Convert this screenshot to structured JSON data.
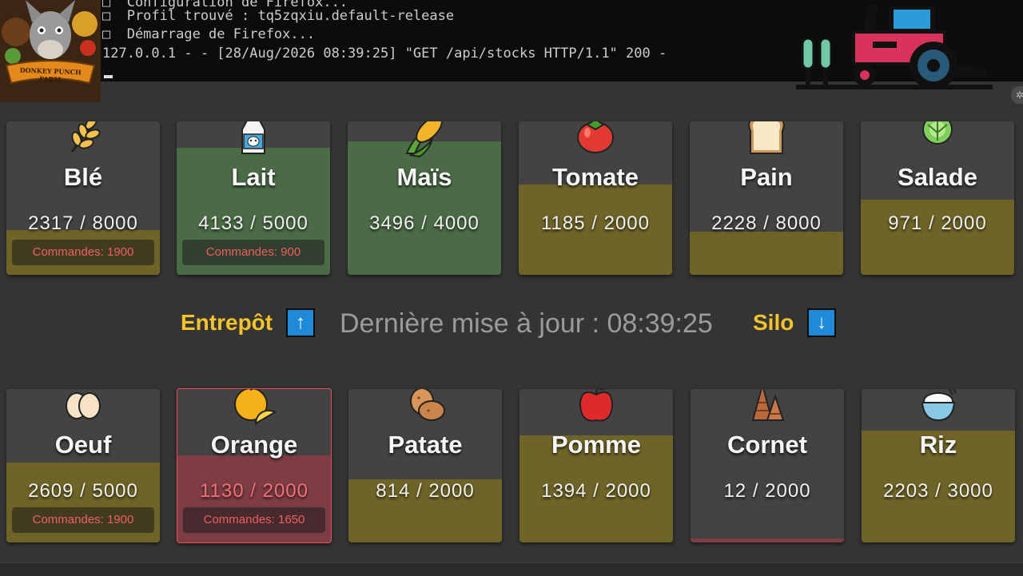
{
  "terminal": {
    "lines": [
      "□  Configuration de Firefox...",
      "□  Profil trouvé : tq5zqxiu.default-release",
      "□  Démarrage de Firefox...",
      "127.0.0.1 - - [28/Aug/2026 08:39:25] \"GET /api/stocks HTTP/1.1\" 200 -"
    ]
  },
  "logo": {
    "text": "DONKEY PUNCH FARM",
    "icon": "donkey-logo"
  },
  "top_row": [
    {
      "name": "Blé",
      "qty": "2317 / 8000",
      "orders": "Commandes: 1900",
      "icon": "wheat-icon",
      "level": 0.29,
      "status": "low"
    },
    {
      "name": "Lait",
      "qty": "4133 / 5000",
      "orders": "Commandes: 900",
      "icon": "milk-bottle-icon",
      "level": 0.83,
      "status": "ok"
    },
    {
      "name": "Maïs",
      "qty": "3496 / 4000",
      "orders": "",
      "icon": "corn-icon",
      "level": 0.87,
      "status": "ok"
    },
    {
      "name": "Tomate",
      "qty": "1185 / 2000",
      "orders": "",
      "icon": "tomato-icon",
      "level": 0.59,
      "status": "low"
    },
    {
      "name": "Pain",
      "qty": "2228 / 8000",
      "orders": "",
      "icon": "bread-icon",
      "level": 0.28,
      "status": "low"
    },
    {
      "name": "Salade",
      "qty": "971 / 2000",
      "orders": "",
      "icon": "lettuce-icon",
      "level": 0.49,
      "status": "low"
    }
  ],
  "bottom_row": [
    {
      "name": "Oeuf",
      "qty": "2609 / 5000",
      "orders": "Commandes: 1900",
      "icon": "egg-icon",
      "level": 0.52,
      "status": "low"
    },
    {
      "name": "Orange",
      "qty": "1130 / 2000",
      "orders": "Commandes: 1650",
      "icon": "orange-icon",
      "level": 0.57,
      "status": "critical"
    },
    {
      "name": "Patate",
      "qty": "814 / 2000",
      "orders": "",
      "icon": "potato-icon",
      "level": 0.41,
      "status": "low"
    },
    {
      "name": "Pomme",
      "qty": "1394 / 2000",
      "orders": "",
      "icon": "apple-icon",
      "level": 0.7,
      "status": "low"
    },
    {
      "name": "Cornet",
      "qty": "12 / 2000",
      "orders": "",
      "icon": "cornet-icon",
      "level": 0.01,
      "status": "critical"
    },
    {
      "name": "Riz",
      "qty": "2203 / 3000",
      "orders": "",
      "icon": "rice-bowl-icon",
      "level": 0.73,
      "status": "low"
    }
  ],
  "middle": {
    "entrepot_label": "Entrepôt",
    "entrepot_arrow": "↑",
    "last_update": "Dernière mise à jour : 08:39:25",
    "silo_label": "Silo",
    "silo_arrow": "↓"
  },
  "colors": {
    "ok": "#4b6b46",
    "low": "#6f6427",
    "critical": "#7d3d43",
    "accent": "#f3c22c",
    "arrow_button": "#1f8ad7",
    "orders_text": "#ef5f5f"
  }
}
